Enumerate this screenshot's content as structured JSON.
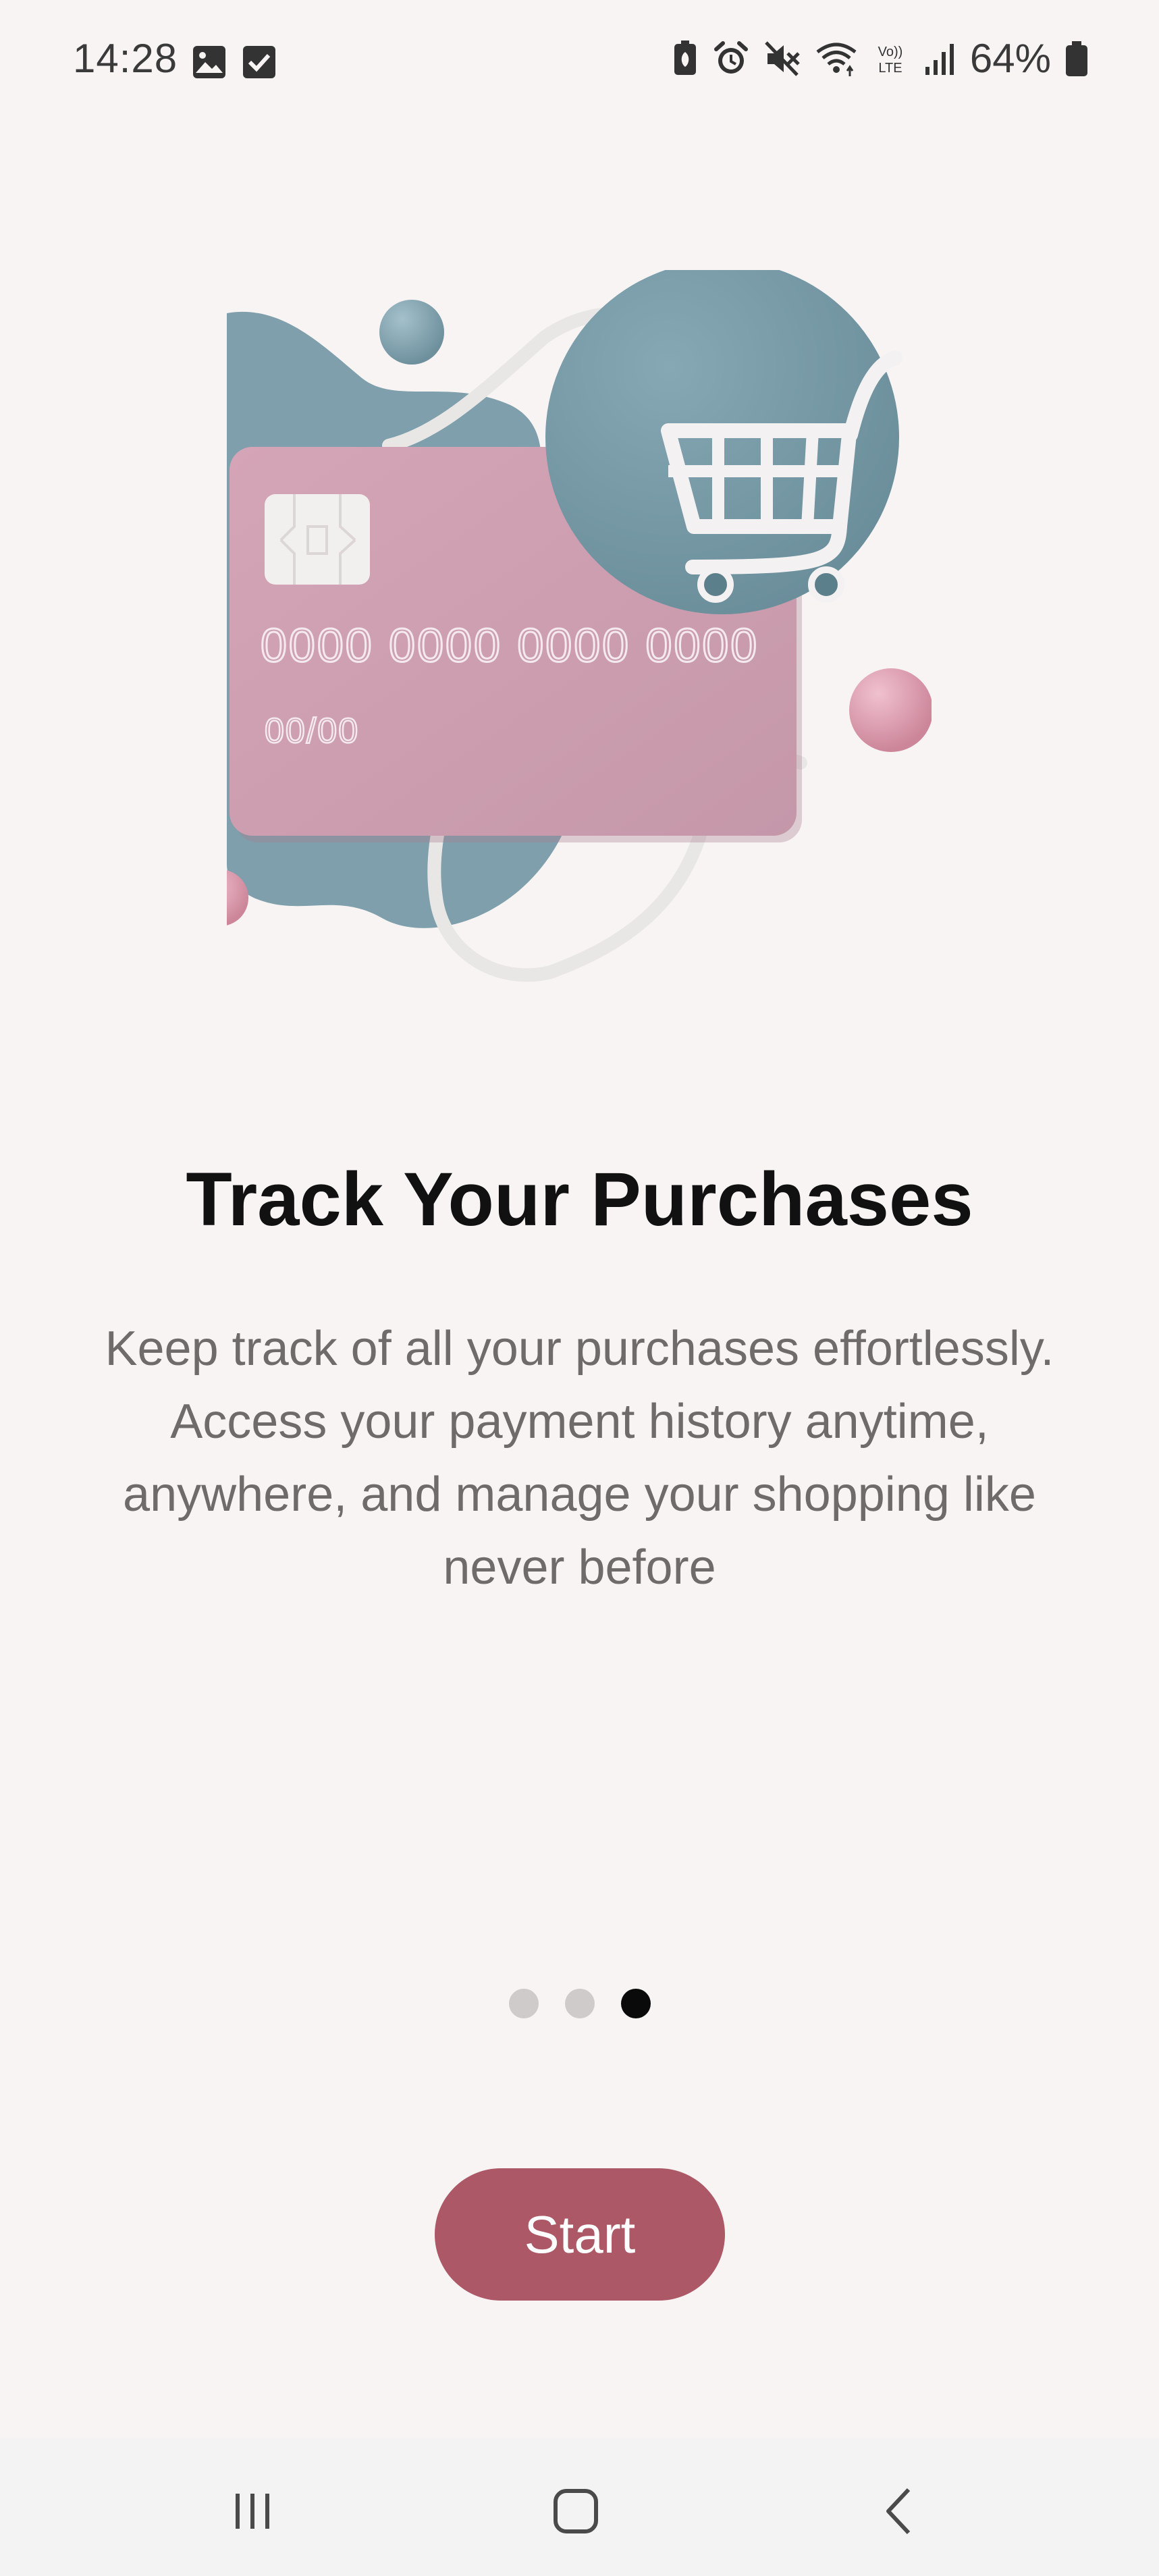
{
  "status_bar": {
    "time": "14:28",
    "battery_percent": "64%",
    "left_icons": [
      "image-icon",
      "checkbox-icon"
    ],
    "right_icons": [
      "battery-saver-icon",
      "alarm-icon",
      "mute-icon",
      "wifi-icon",
      "volte-icon",
      "signal-icon",
      "battery-icon"
    ]
  },
  "illustration": {
    "card_number": "0000 0000 0000 0000",
    "card_expiry": "00/00",
    "colors": {
      "card": "#c99aae",
      "blob": "#7e9fab",
      "sphere_pink": "#d795a8"
    }
  },
  "onboarding": {
    "title": "Track Your Purchases",
    "description": "Keep track of all your purchases effortlessly. Access your payment history anytime, anywhere, and manage your shopping like never before",
    "page_count": 3,
    "current_page": 3
  },
  "start_button": {
    "label": "Start",
    "color": "#ad5866"
  },
  "nav_bar": {
    "icons": [
      "recent-apps-icon",
      "home-icon",
      "back-icon"
    ]
  }
}
